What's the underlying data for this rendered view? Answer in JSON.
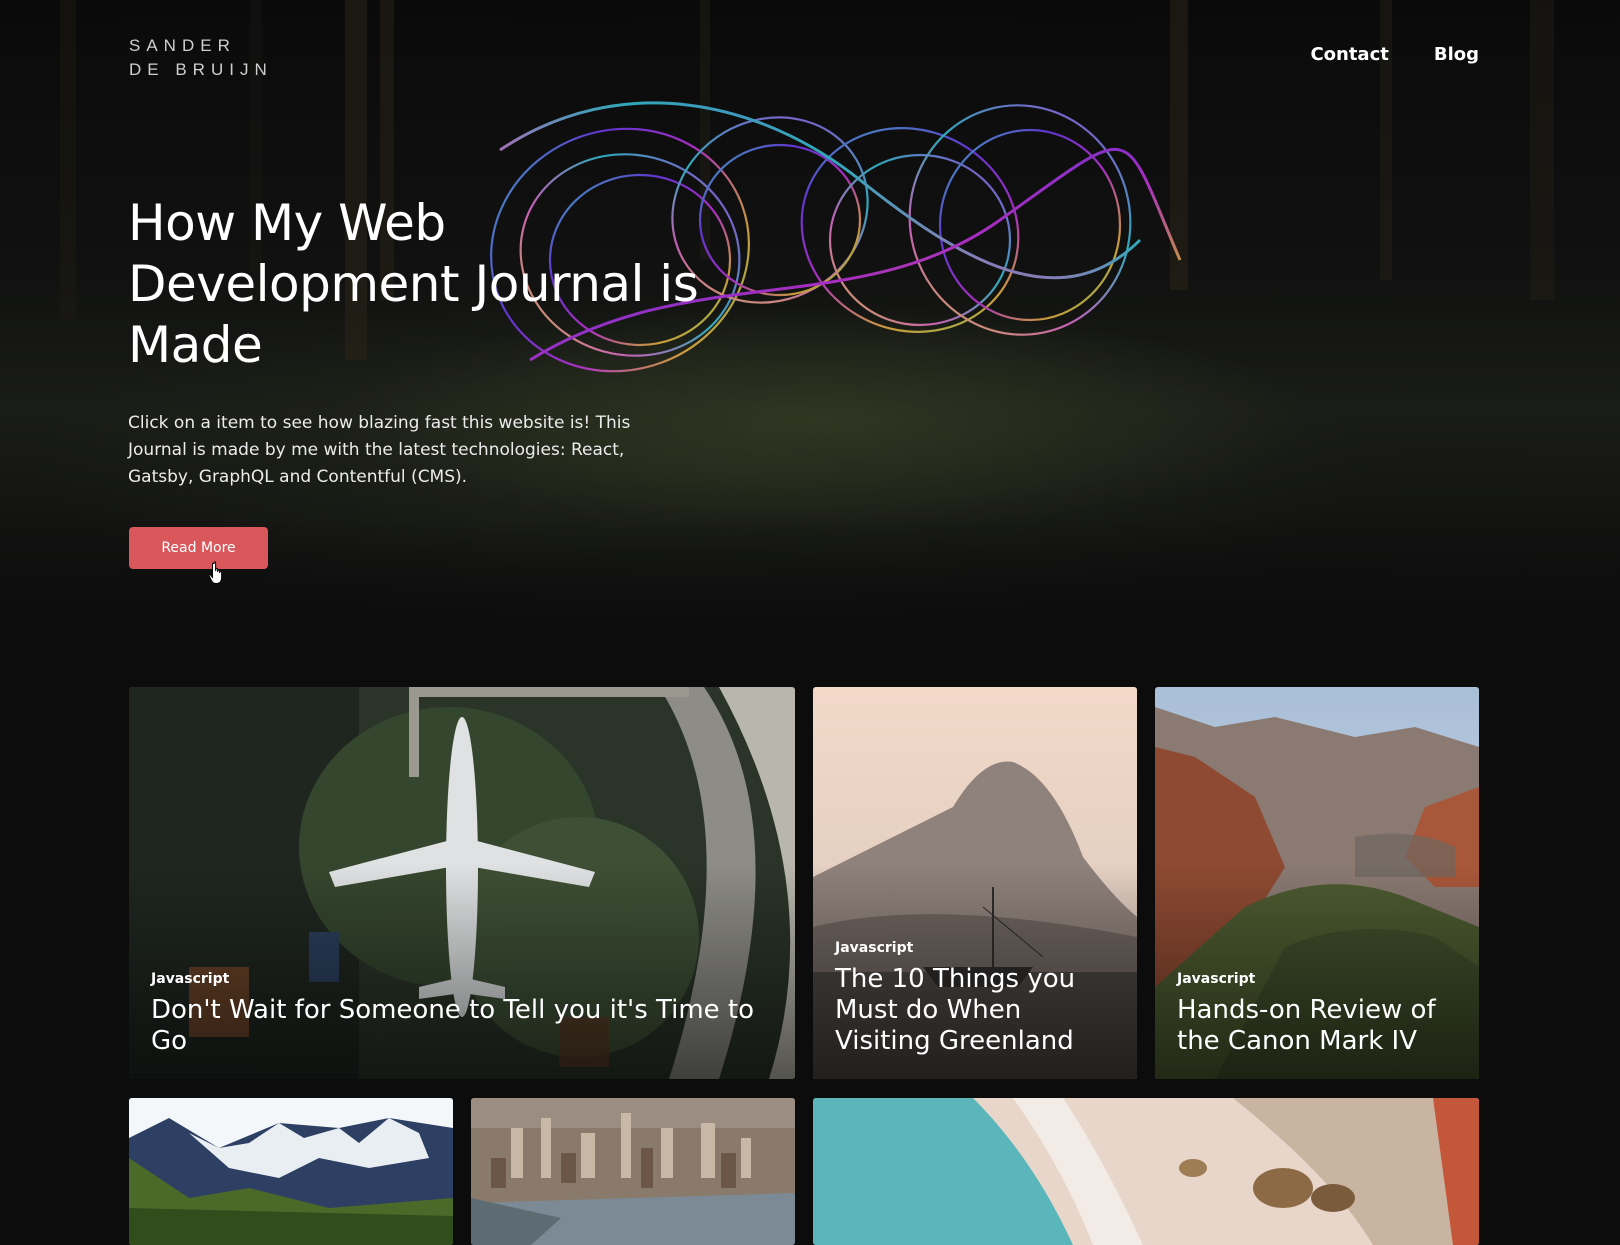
{
  "header": {
    "logo_line1": "SANDER",
    "logo_line2": "DE BRUIJN",
    "nav": [
      {
        "label": "Contact"
      },
      {
        "label": "Blog"
      }
    ]
  },
  "hero": {
    "title": "How My Web Development Journal is Made",
    "description": "Click on a item to see how blazing fast this website is! This Journal is made by me with the latest technologies: React, Gatsby, GraphQL and Contentful (CMS).",
    "button_label": "Read More",
    "button_color": "#d9575a"
  },
  "posts": [
    {
      "tag": "Javascript",
      "title": "Don't Wait for Someone to Tell you it's Time to Go",
      "image": "airplane-aerial"
    },
    {
      "tag": "Javascript",
      "title": "The 10 Things you Must do When Visiting Greenland",
      "image": "mountain-boat"
    },
    {
      "tag": "Javascript",
      "title": "Hands-on Review of the Canon Mark IV",
      "image": "canyon-valley"
    },
    {
      "tag": "",
      "title": "",
      "image": "snowy-mountains"
    },
    {
      "tag": "",
      "title": "",
      "image": "city-aerial"
    },
    {
      "tag": "",
      "title": "",
      "image": "beach-aerial"
    }
  ]
}
